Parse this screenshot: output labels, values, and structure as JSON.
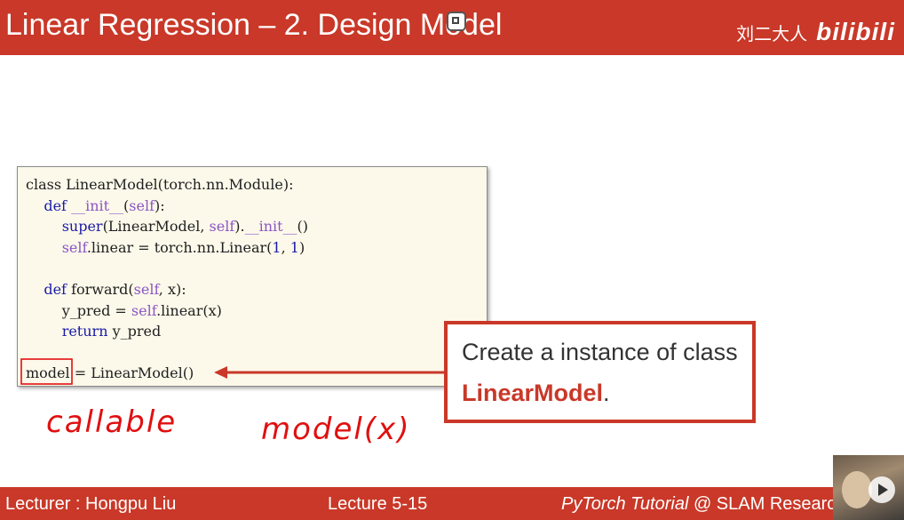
{
  "header": {
    "title": "Linear Regression – 2. Design Model",
    "author": "刘二大人",
    "logo": "bilibili"
  },
  "code": {
    "lines": [
      [
        {
          "t": "class LinearModel(torch.nn.Module):",
          "c": ""
        }
      ],
      [
        {
          "t": "    ",
          "c": ""
        },
        {
          "t": "def",
          "c": "kw"
        },
        {
          "t": " ",
          "c": ""
        },
        {
          "t": "__init__",
          "c": "dunder"
        },
        {
          "t": "(",
          "c": ""
        },
        {
          "t": "self",
          "c": "selfkw"
        },
        {
          "t": "):",
          "c": ""
        }
      ],
      [
        {
          "t": "        ",
          "c": ""
        },
        {
          "t": "super",
          "c": "kw"
        },
        {
          "t": "(LinearModel, ",
          "c": ""
        },
        {
          "t": "self",
          "c": "selfkw"
        },
        {
          "t": ").",
          "c": ""
        },
        {
          "t": "__init__",
          "c": "dunder"
        },
        {
          "t": "()",
          "c": ""
        }
      ],
      [
        {
          "t": "        ",
          "c": ""
        },
        {
          "t": "self",
          "c": "selfkw"
        },
        {
          "t": ".linear = torch.nn.Linear(",
          "c": ""
        },
        {
          "t": "1",
          "c": "num"
        },
        {
          "t": ", ",
          "c": ""
        },
        {
          "t": "1",
          "c": "num"
        },
        {
          "t": ")",
          "c": ""
        }
      ],
      [
        {
          "t": "",
          "c": ""
        }
      ],
      [
        {
          "t": "    ",
          "c": ""
        },
        {
          "t": "def",
          "c": "kw"
        },
        {
          "t": " forward(",
          "c": ""
        },
        {
          "t": "self",
          "c": "selfkw"
        },
        {
          "t": ", x):",
          "c": ""
        }
      ],
      [
        {
          "t": "        y_pred = ",
          "c": ""
        },
        {
          "t": "self",
          "c": "selfkw"
        },
        {
          "t": ".linear(x)",
          "c": ""
        }
      ],
      [
        {
          "t": "        ",
          "c": ""
        },
        {
          "t": "return",
          "c": "kw"
        },
        {
          "t": " y_pred",
          "c": ""
        }
      ],
      [
        {
          "t": "",
          "c": ""
        }
      ],
      [
        {
          "t": "model = LinearModel()",
          "c": ""
        }
      ]
    ]
  },
  "callout": {
    "line1": "Create a instance of class",
    "class_name": "LinearModel",
    "period": "."
  },
  "annotations": {
    "left_note": "callable",
    "right_note": "model(x)"
  },
  "footer": {
    "lecturer": "Lecturer : Hongpu Liu",
    "lecture": "Lecture 5-15",
    "course": "PyTorch Tutorial",
    "org": " @ SLAM Research"
  },
  "colors": {
    "accent": "#c93828",
    "code_bg": "#fdf9ea",
    "keyword": "#1a1aa6",
    "dunder": "#8a55c6",
    "ink": "#e01010"
  }
}
